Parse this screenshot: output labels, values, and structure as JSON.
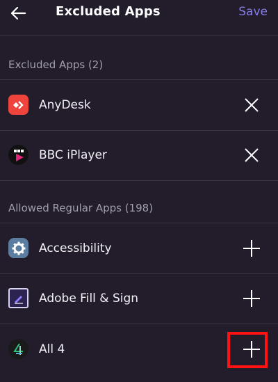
{
  "header": {
    "title": "Excluded Apps",
    "save_label": "Save",
    "back_icon": "arrow-left-icon"
  },
  "excluded": {
    "heading": "Excluded Apps (2)",
    "items": [
      {
        "label": "AnyDesk",
        "icon": "anydesk-icon",
        "action_icon": "close-icon"
      },
      {
        "label": "BBC iPlayer",
        "icon": "bbc-iplayer-icon",
        "action_icon": "close-icon"
      }
    ]
  },
  "allowed": {
    "heading": "Allowed Regular Apps (198)",
    "items": [
      {
        "label": "Accessibility",
        "icon": "gear-icon",
        "action_icon": "plus-icon"
      },
      {
        "label": "Adobe Fill & Sign",
        "icon": "adobe-fill-sign-icon",
        "action_icon": "plus-icon"
      },
      {
        "label": "All 4",
        "icon": "all4-icon",
        "action_icon": "plus-icon",
        "highlighted": true
      }
    ]
  },
  "colors": {
    "background": "#221c2b",
    "accent": "#8a7ee8",
    "divider": "#3a3443",
    "highlight": "#ff1212"
  }
}
